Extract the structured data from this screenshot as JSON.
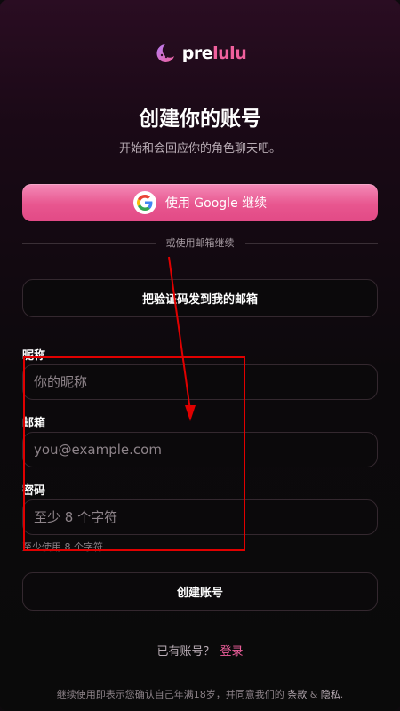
{
  "logo": {
    "brand_main": "pre",
    "brand_accent": "lulu",
    "icon": "moon-logo-icon"
  },
  "title": "创建你的账号",
  "subtitle": "开始和会回应你的角色聊天吧。",
  "google_button": {
    "label": "使用 Google 继续",
    "icon": "google-icon"
  },
  "divider_text": "或使用邮箱继续",
  "send_code_button": "把验证码发到我的邮箱",
  "form": {
    "nickname": {
      "label": "昵称",
      "placeholder": "你的昵称",
      "value": ""
    },
    "email": {
      "label": "邮箱",
      "placeholder": "you@example.com",
      "value": ""
    },
    "password": {
      "label": "密码",
      "placeholder": "至少 8 个字符",
      "value": ""
    },
    "password_hint": "至少使用 8 个字符"
  },
  "create_button": "创建账号",
  "signin": {
    "prompt": "已有账号？",
    "link": "登录"
  },
  "footer": {
    "prefix": "继续使用即表示您确认自己年满18岁，并同意我们的",
    "terms": "条款",
    "amp": "&",
    "privacy": "隐私",
    "suffix": "."
  },
  "colors": {
    "accent": "#f0609d",
    "button_gradient_top": "#f48bb8",
    "button_gradient_bottom": "#e24a86",
    "annotation": "#e00000"
  }
}
